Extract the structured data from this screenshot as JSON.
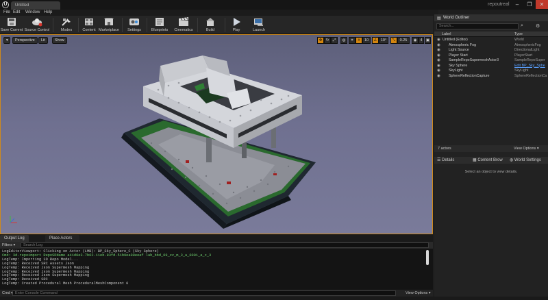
{
  "window": {
    "tab_title": "Untitled",
    "project_name": "repoutreal",
    "min": "–",
    "max": "❐",
    "close": "✕"
  },
  "menu": [
    "File",
    "Edit",
    "Window",
    "Help"
  ],
  "toolbar": [
    {
      "label": "Save Current",
      "icon": "save-icon"
    },
    {
      "label": "Source Control",
      "icon": "source-control-icon"
    },
    {
      "label": "Modes",
      "icon": "modes-icon"
    },
    {
      "label": "Content",
      "icon": "content-icon"
    },
    {
      "label": "Marketplace",
      "icon": "marketplace-icon"
    },
    {
      "label": "Settings",
      "icon": "settings-icon"
    },
    {
      "label": "Blueprints",
      "icon": "blueprints-icon"
    },
    {
      "label": "Cinematics",
      "icon": "cinematics-icon"
    },
    {
      "label": "Build",
      "icon": "build-icon"
    },
    {
      "label": "Play",
      "icon": "play-icon"
    },
    {
      "label": "Launch",
      "icon": "launch-icon"
    }
  ],
  "viewport": {
    "perspective": "Perspective",
    "lit": "Lit",
    "show": "Show",
    "grid_snap": "10",
    "rot_snap": "10°",
    "scale_snap": "0.25",
    "cam_speed": "4"
  },
  "log": {
    "tab_output": "Output Log",
    "tab_place": "Place Actors",
    "filters": "Filters ▾",
    "search_placeholder": "Search Log",
    "lines": [
      {
        "text": "LogEditorViewport: Clicking on Actor (LMB): BP_Sky_Sphere_C (Sky Sphere)",
        "green": false
      },
      {
        "text": "Cmd: 3d-repoimport RepoSDName a41d0e3-7b62-11eb-83fd-51b9ea08eeaf lab_bbd_09_zz_m_3_a_0001_a_c_3",
        "green": true
      },
      {
        "text": "LogTemp: Importing 3D Repo Model...",
        "green": false
      },
      {
        "text": "LogTemp: Received SRC Assets Json",
        "green": false
      },
      {
        "text": "LogTemp: Received Json Supermesh Mapping",
        "green": false
      },
      {
        "text": "LogTemp: Received Json Supermesh Mapping",
        "green": false
      },
      {
        "text": "LogTemp: Received Json Supermesh Mapping",
        "green": false
      },
      {
        "text": "LogTemp: Received SRC",
        "green": false
      },
      {
        "text": "LogTemp: Created Procedural Mesh ProceduralMeshComponent 0",
        "green": false
      }
    ],
    "cmd_label": "Cmd ▾",
    "cmd_placeholder": "Enter Console Command",
    "view_options": "View Options ▾"
  },
  "outliner": {
    "title": "World Outliner",
    "search_placeholder": "Search...",
    "col_label": "Label",
    "col_type": "Type",
    "rows": [
      {
        "label": "Untitled (Editor)",
        "type": "World",
        "indent": 0,
        "highlight": false
      },
      {
        "label": "Atmospheric Fog",
        "type": "AtmosphericFog",
        "indent": 1,
        "highlight": false
      },
      {
        "label": "Light Source",
        "type": "DirectionalLight",
        "indent": 1,
        "highlight": false
      },
      {
        "label": "Player Start",
        "type": "PlayerStart",
        "indent": 1,
        "highlight": false
      },
      {
        "label": "SampleRepoSupermeshActor3",
        "type": "SampleRepoSuper",
        "indent": 1,
        "highlight": false
      },
      {
        "label": "Sky Sphere",
        "type": "Edit BP_Sky_Sphe",
        "indent": 1,
        "highlight": true
      },
      {
        "label": "SkyLight",
        "type": "SkyLight",
        "indent": 1,
        "highlight": false
      },
      {
        "label": "SphereReflectionCapture",
        "type": "SphereReflectionCa",
        "indent": 1,
        "highlight": false
      }
    ],
    "actor_count": "7 actors",
    "view_options": "View Options ▾"
  },
  "details": {
    "tab_details": "Details",
    "tab_content": "Content Brow",
    "tab_world": "World Settings",
    "empty_msg": "Select an object to view details."
  }
}
